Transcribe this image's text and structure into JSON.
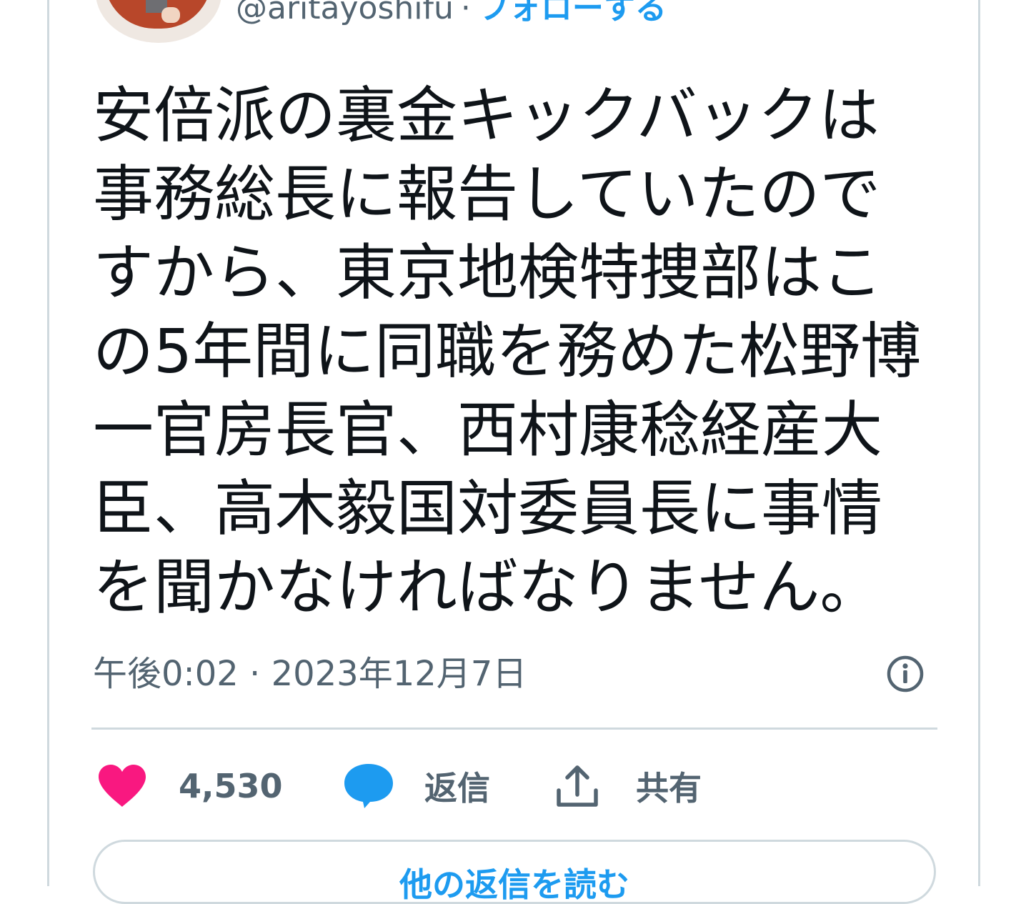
{
  "author": {
    "handle": "@aritayoshifu",
    "separator": "·",
    "follow_label": "フォローする"
  },
  "tweet": {
    "lines": [
      "安倍派の裏金キックバックは",
      "事務総長に報告していたので",
      "すから、東京地検特捜部はこ",
      "の5年間に同職を務めた松野博",
      "一官房長官、西村康稔経産大",
      "臣、高木毅国対委員長に事情",
      "を聞かなければなりません。"
    ],
    "timestamp": "午後0:02 · 2023年12月7日"
  },
  "actions": {
    "like_count": "4,530",
    "reply_label": "返信",
    "share_label": "共有"
  },
  "read_replies_label": "他の返信を読む",
  "colors": {
    "accent": "#1d9bf0",
    "like": "#f91880",
    "muted_text": "#536471",
    "border": "#cfd9de"
  }
}
